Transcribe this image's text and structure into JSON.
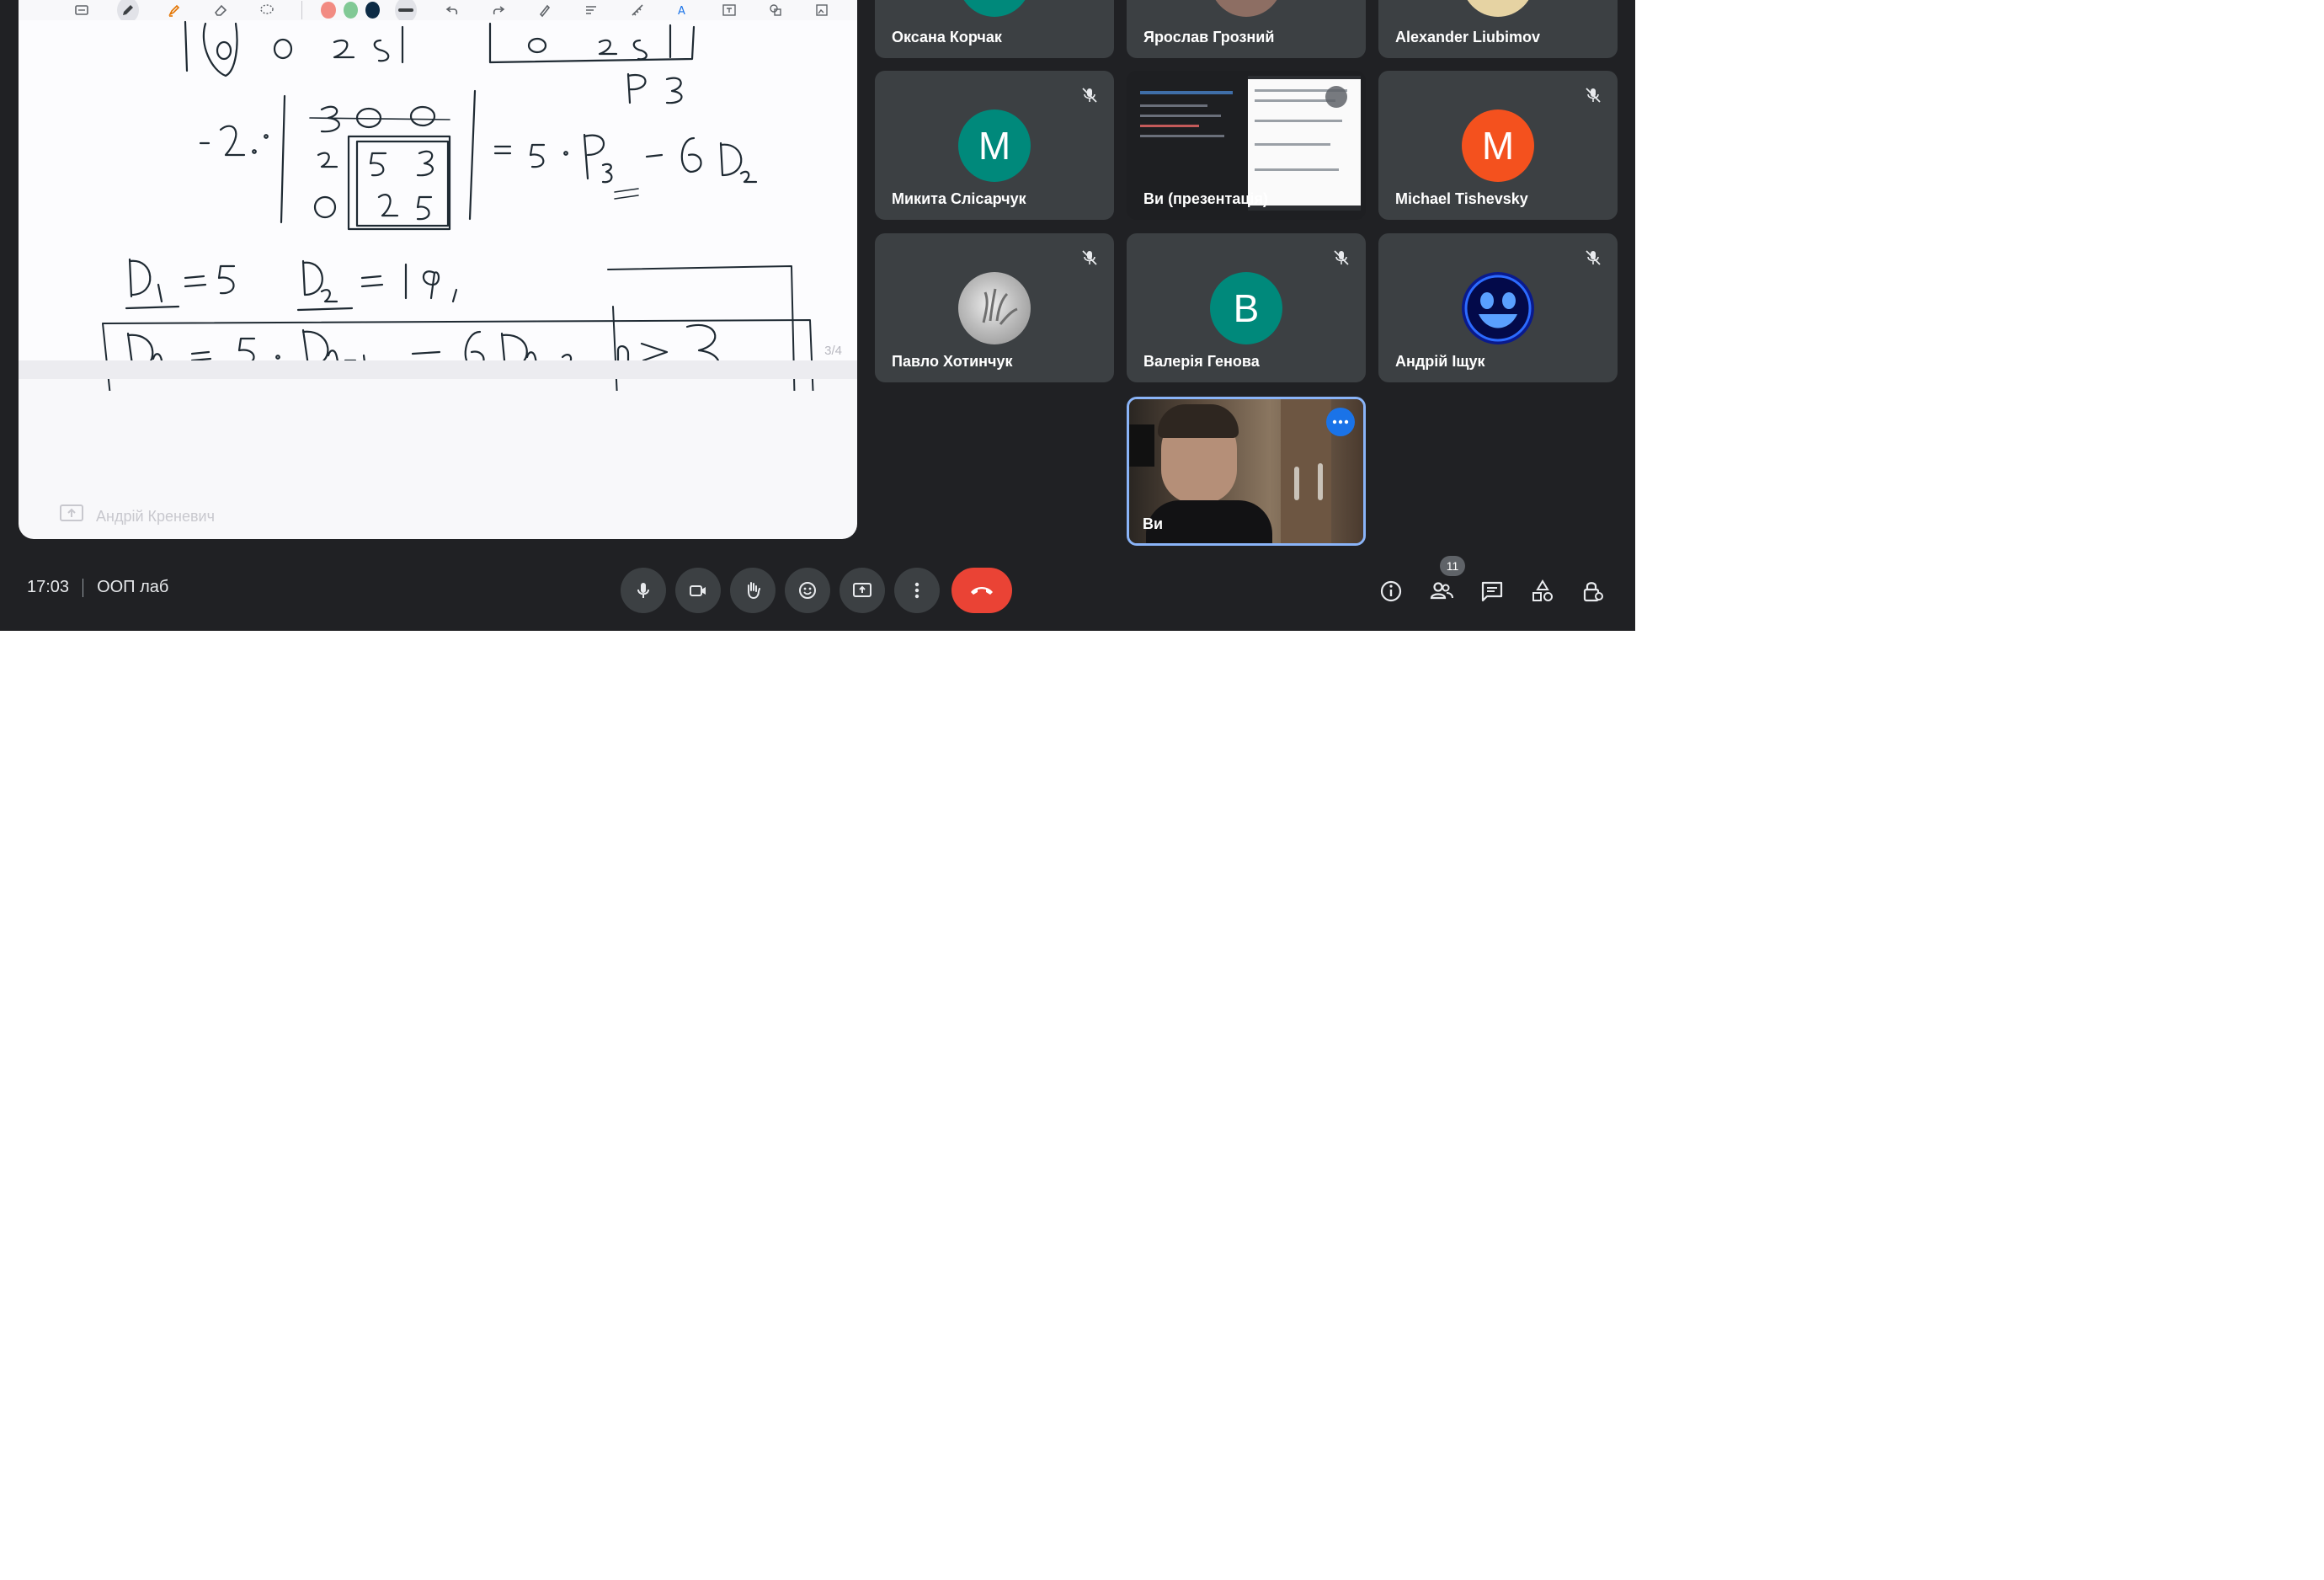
{
  "meeting": {
    "time": "17:03",
    "title": "ООП лаб",
    "participants_count": "11"
  },
  "presentation": {
    "page_indicator": "3/4",
    "presenter_label": "Андрій Креневич",
    "pen_colors": [
      "#f28b82",
      "#81c995",
      "#0d2b45"
    ]
  },
  "participants": [
    {
      "name": "Оксана Корчак",
      "avatar_color": "#00897b"
    },
    {
      "name": "Ярослав Грозний",
      "avatar_color": "#8d6e63"
    },
    {
      "name": "Alexander Liubimov",
      "avatar_color": "#e6d3a3"
    },
    {
      "name": "Микита Слісарчук",
      "initial": "M",
      "avatar_color": "#00897b"
    },
    {
      "name": "Ви (презентація)",
      "avatar_color": "#1e1f22"
    },
    {
      "name": "Michael Tishevsky",
      "initial": "M",
      "avatar_color": "#f4511e"
    },
    {
      "name": "Павло Хотинчук",
      "avatar_color": "#9e9e9e"
    },
    {
      "name": "Валерія Генова",
      "initial": "B",
      "avatar_color": "#00897b"
    },
    {
      "name": "Андрій Іщук",
      "avatar_color": "#0a1a8c"
    },
    {
      "name": "Ви",
      "avatar_color": "#6d5a4a"
    }
  ],
  "colors": {
    "background": "#202124",
    "tile": "#3c4043",
    "hangup": "#ea4335",
    "self_tile_border": "#8ab4f8",
    "more_options": "#1a73e8"
  }
}
